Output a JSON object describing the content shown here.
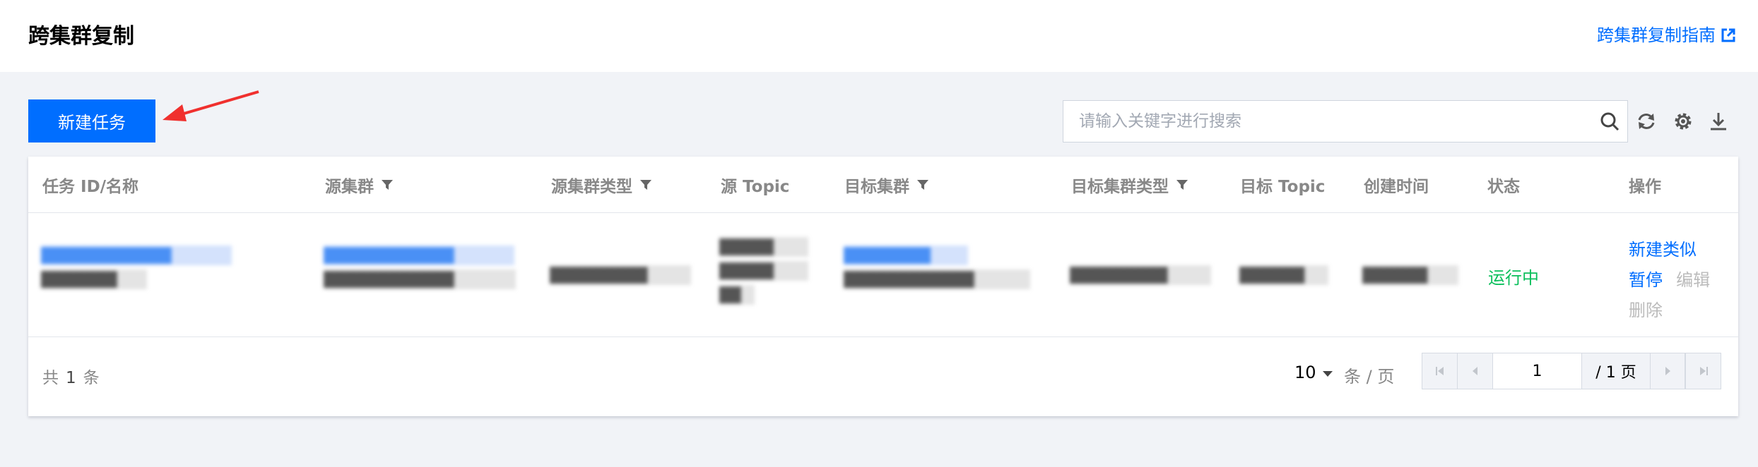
{
  "header": {
    "title": "跨集群复制",
    "guide_link": "跨集群复制指南"
  },
  "toolbar": {
    "new_task_label": "新建任务",
    "search_placeholder": "请输入关键字进行搜索",
    "icons": [
      "refresh-icon",
      "settings-icon",
      "download-icon"
    ]
  },
  "table": {
    "columns": [
      {
        "label": "任务 ID/名称",
        "filter": false
      },
      {
        "label": "源集群",
        "filter": true
      },
      {
        "label": "源集群类型",
        "filter": true
      },
      {
        "label": "源 Topic",
        "filter": false
      },
      {
        "label": "目标集群",
        "filter": true
      },
      {
        "label": "目标集群类型",
        "filter": true
      },
      {
        "label": "目标 Topic",
        "filter": false
      },
      {
        "label": "创建时间",
        "filter": false
      },
      {
        "label": "状态",
        "filter": false
      },
      {
        "label": "操作",
        "filter": false
      }
    ],
    "rows": [
      {
        "task_id": "████████████",
        "task_name": "███████",
        "source_cluster_id": "████████████",
        "source_cluster_name": "████████████",
        "source_cluster_type": "█████████",
        "source_topic": [
          "█████",
          "█████",
          "██"
        ],
        "target_cluster_id": "████████",
        "target_cluster_name": "████████████",
        "target_cluster_type": "█████████",
        "target_topic": "██████",
        "created_time": "██████",
        "status": "运行中",
        "actions": {
          "create_similar": "新建类似",
          "pause": "暂停",
          "edit": "编辑",
          "delete": "删除"
        }
      }
    ]
  },
  "footer": {
    "total_prefix": "共",
    "total_count": "1",
    "total_suffix": "条",
    "page_size": "10",
    "page_size_unit": "条 / 页",
    "current_page": "1",
    "total_pages": "/ 1 页"
  },
  "colors": {
    "primary": "#006eff",
    "status_running": "#0abf5b",
    "page_background": "#f1f3f7",
    "header_text": "#888888"
  }
}
